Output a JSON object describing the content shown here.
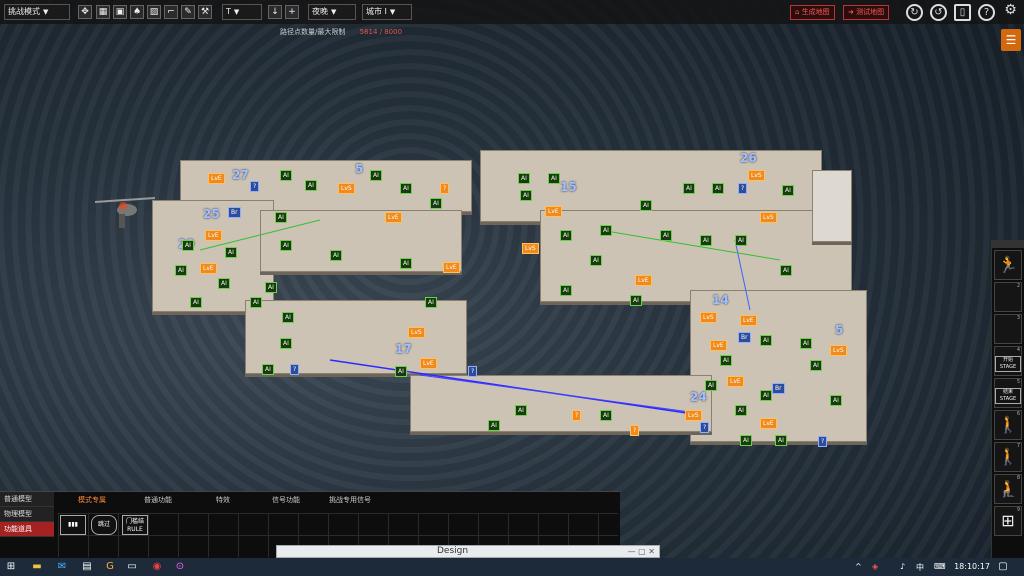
{
  "toolbar": {
    "mode_select": "挑战模式",
    "level_select": "T",
    "time_select": "夜晚",
    "map_select": "城市 I",
    "counter_label": "路径点数量/最大限制",
    "counter_value": "5814 / 8000",
    "generate_button": "生成地图",
    "test_button": "测试地图",
    "icons": [
      "move-icon",
      "grid-icon",
      "layer-icon",
      "spawn-icon",
      "paint-icon",
      "stairs-icon",
      "eraser-icon",
      "wrench-icon"
    ]
  },
  "map": {
    "zone_labels": [
      "27",
      "25",
      "5",
      "26",
      "29",
      "15",
      "14",
      "5",
      "17",
      "24"
    ],
    "tags": {
      "ai": "AI",
      "lve": "LvE",
      "lvs": "LvS",
      "unknown": "?",
      "br": "Br"
    }
  },
  "right_sidebar": {
    "slots": [
      {
        "num": "",
        "label": "",
        "icon": "runner-icon"
      },
      {
        "num": "2",
        "label": "",
        "icon": "empty"
      },
      {
        "num": "3",
        "label": "",
        "icon": "empty"
      },
      {
        "num": "4",
        "label": "开始 STAGE",
        "icon": "stage-start"
      },
      {
        "num": "5",
        "label": "结束 STAGE",
        "icon": "stage-end"
      },
      {
        "num": "6",
        "label": "",
        "icon": "person-icon"
      },
      {
        "num": "7",
        "label": "",
        "icon": "walker-icon"
      },
      {
        "num": "8",
        "label": "",
        "icon": "crouch-icon"
      },
      {
        "num": "9",
        "label": "",
        "icon": "network-icon"
      }
    ]
  },
  "bottom_panel": {
    "left_menu": [
      "普通模型",
      "物理模型",
      "功能道具"
    ],
    "tabs": [
      "模式专属",
      "普通功能",
      "特效",
      "信号功能",
      "挑战专用信号"
    ],
    "grid_items": [
      "bottles-icon",
      "hexagon-icon",
      "rule-icon"
    ],
    "grid_labels": [
      "",
      "跳过",
      "门槛结 RULE"
    ]
  },
  "design_window": {
    "title": "Design"
  },
  "taskbar": {
    "clock": "18:10:17",
    "ime": "中",
    "icons": [
      "windows-icon",
      "folder-icon",
      "mail-icon",
      "files-icon",
      "browser-icon",
      "terminal-icon",
      "app-icon",
      "game-icon"
    ]
  }
}
